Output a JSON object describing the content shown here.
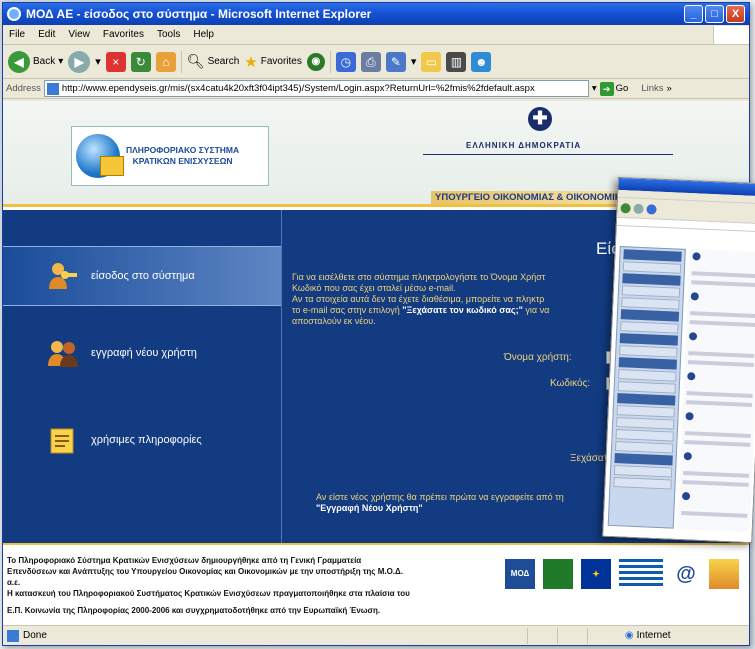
{
  "window": {
    "title": "ΜΟΔ ΑΕ - είσοδος στο σύστημα - Microsoft Internet Explorer",
    "controls": [
      "_",
      "□",
      "X"
    ]
  },
  "menu": [
    "File",
    "Edit",
    "View",
    "Favorites",
    "Tools",
    "Help"
  ],
  "toolbar": {
    "back": "Back",
    "search": "Search",
    "favorites": "Favorites"
  },
  "address": {
    "label": "Address",
    "url": "http://www.ependyseis.gr/mis/(sx4catu4k20xft3f04ipt345)/System/Login.aspx?ReturnUrl=%2fmis%2fdefault.aspx",
    "go": "Go",
    "links": "Links"
  },
  "header": {
    "logo_line1": "ΠΛΗΡΟΦΟΡΙΑΚΟ ΣΥΣΤΗΜΑ",
    "logo_line2": "ΚΡΑΤΙΚΩΝ ΕΝΙΣΧΥΣΕΩΝ",
    "country": "ΕΛΛΗΝΙΚΗ ΔΗΜΟΚΡΑΤΙΑ",
    "ministry": "ΥΠΟΥΡΓΕΙΟ ΟΙΚΟΝΟΜΙΑΣ & ΟΙΚΟΝΟΜΙΚΩΝ"
  },
  "sidebar": {
    "items": [
      {
        "label": "είσοδος στο σύστημα",
        "active": true
      },
      {
        "label": "εγγραφή νέου χρήστη",
        "active": false
      },
      {
        "label": "χρήσιμες πληροφορίες",
        "active": false
      }
    ]
  },
  "login": {
    "title": "Είσοδος στο σύ",
    "instructions_1": "Για να εισέλθετε στο σύστημα πληκτρολογήστε το Όνομα Χρήστ",
    "instructions_2": "Κωδικό που σας έχει σταλεί μέσω e-mail.",
    "instructions_3": "Αν τα στοιχεία αυτά δεν τα έχετε διαθέσιμα, μπορείτε να πληκτρ",
    "instructions_4a": "το e-mail σας στην επιλογή",
    "instructions_4b": "\"Ξεχάσατε τον κωδικό σας;\"",
    "instructions_4c": "για να",
    "instructions_5": "αποσταλούν εκ νέου.",
    "username_label": "Όνομα χρήστη:",
    "password_label": "Κωδικός:",
    "forgot": "Ξεχάσατε το",
    "newuser_1": "Αν είστε νέος χρήστης θα πρέπει πρώτα να εγγραφείτε από τη",
    "newuser_2": "\"Εγγραφή Νέου Χρήστη\""
  },
  "footer": {
    "line1": "Το Πληροφοριακό Σύστημα Κρατικών Ενισχύσεων δημιουργήθηκε από τη Γενική Γραμματεία",
    "line2": "Επενδύσεων και Ανάπτυξης του Υπουργείου Οικονομίας και Οικονομικών με την υποστήριξη της Μ.Ο.Δ.",
    "line3": "α.ε.",
    "line4": "Η κατασκευή του Πληροφοριακού Συστήματος Κρατικών Ενισχύσεων πραγματοποιήθηκε στα πλαίσια του",
    "line5": "Ε.Π. Κοινωνία της Πληροφορίας 2000-2006 και συγχρηματοδοτήθηκε από την Ευρωπαϊκή Ένωση.",
    "mod_logo": "ΜΟΔ"
  },
  "status": {
    "left": "Done",
    "zone": "Internet"
  },
  "colors": {
    "title_bar": "#1553d6",
    "page_bg": "#123b82",
    "accent_text": "#f0d27a",
    "header_line": "#f0c040"
  }
}
